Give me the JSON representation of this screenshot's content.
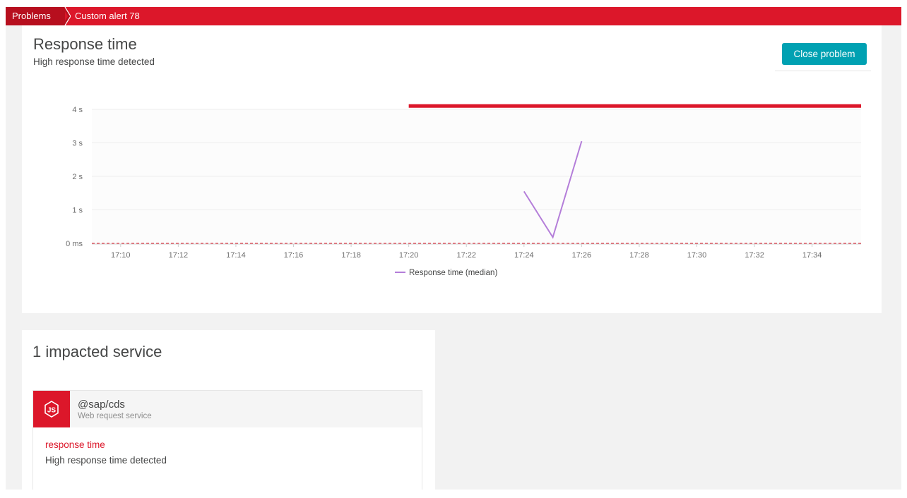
{
  "breadcrumb": {
    "items": [
      {
        "label": "Problems"
      },
      {
        "label": "Custom alert 78"
      }
    ]
  },
  "problem": {
    "title": "Response time",
    "subtitle": "High response time detected",
    "close_button_label": "Close problem"
  },
  "colors": {
    "brand_red": "#dc172a",
    "breadcrumb_dark": "#b70f1e",
    "button_teal": "#00a1b2",
    "series_line": "#b47ed9",
    "threshold_line": "#dc172a",
    "page_bg": "#f2f2f2"
  },
  "chart_data": {
    "type": "line",
    "y_tick_labels": [
      "0 ms",
      "1 s",
      "2 s",
      "3 s",
      "4 s"
    ],
    "y_tick_values": [
      0,
      1,
      2,
      3,
      4
    ],
    "ylim": [
      0,
      4
    ],
    "x_tick_labels": [
      "17:10",
      "17:12",
      "17:14",
      "17:16",
      "17:18",
      "17:20",
      "17:22",
      "17:24",
      "17:26",
      "17:28",
      "17:30",
      "17:32",
      "17:34"
    ],
    "x_tick_values": [
      10,
      12,
      14,
      16,
      18,
      20,
      22,
      24,
      26,
      28,
      30,
      32,
      34
    ],
    "xlim": [
      9,
      35.7
    ],
    "grid": true,
    "legend_position": "bottom-center",
    "series": [
      {
        "name": "Response time (median)",
        "color": "#b47ed9",
        "points": [
          {
            "x": 24,
            "y": 1.55
          },
          {
            "x": 25,
            "y": 0.18
          },
          {
            "x": 26,
            "y": 3.05
          }
        ]
      }
    ],
    "problem_period": {
      "x_start": 20,
      "x_end": 35.7,
      "y": 4.1,
      "color": "#dc172a"
    },
    "baseline": {
      "y": 0,
      "color": "#dc172a"
    }
  },
  "impacted": {
    "title": "1 impacted service",
    "services": [
      {
        "name": "@sap/cds",
        "type": "Web request service",
        "icon": "nodejs-icon",
        "metric": "response time",
        "description": "High response time detected"
      }
    ]
  }
}
